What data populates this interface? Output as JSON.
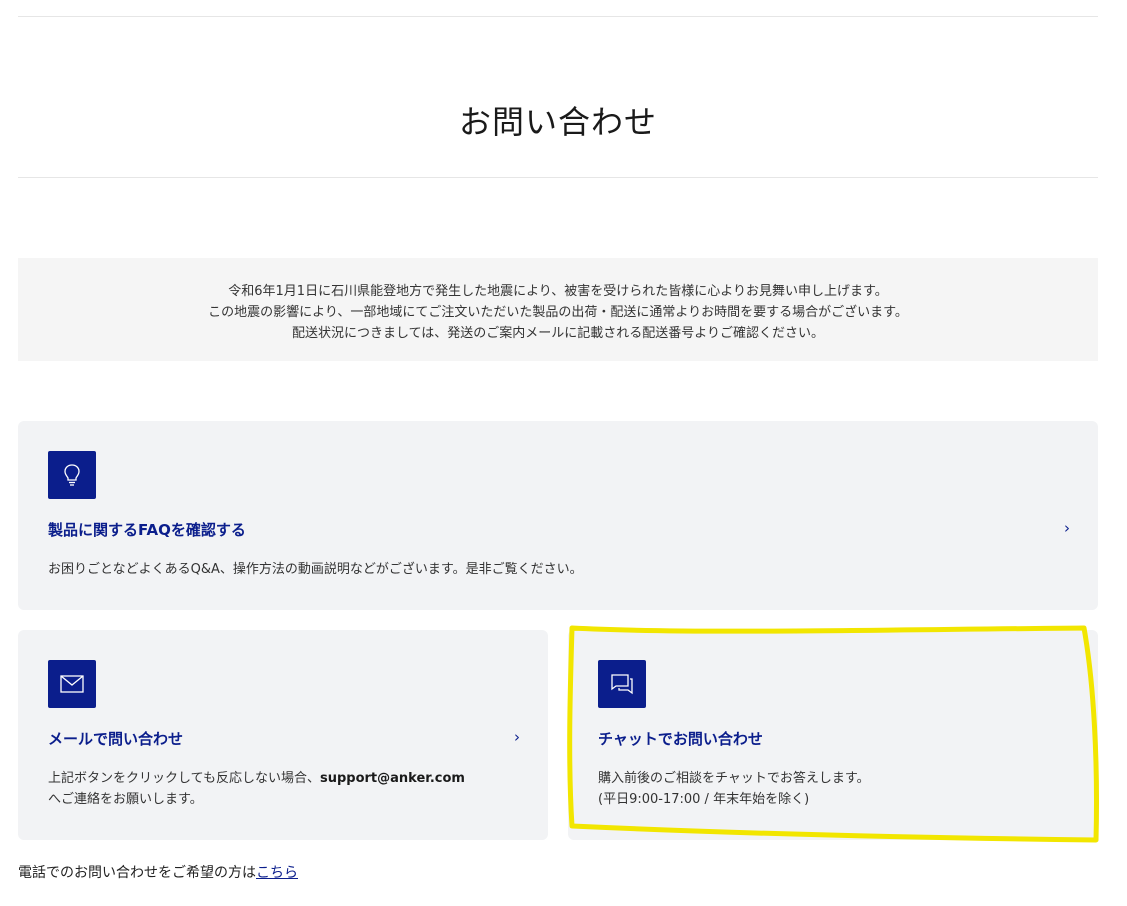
{
  "header": {
    "title": "お問い合わせ"
  },
  "notice": {
    "lines": [
      "令和6年1月1日に石川県能登地方で発生した地震により、被害を受けられた皆様に心よりお見舞い申し上げます。",
      "この地震の影響により、一部地域にてご注文いただいた製品の出荷・配送に通常よりお時間を要する場合がございます。",
      "配送状況につきましては、発送のご案内メールに記載される配送番号よりご確認ください。"
    ]
  },
  "cards": {
    "faq": {
      "icon": "lightbulb-icon",
      "title": "製品に関するFAQを確認する",
      "chevron": "›",
      "description": "お困りごとなどよくあるQ&A、操作方法の動画説明などがございます。是非ご覧ください。"
    },
    "mail": {
      "icon": "envelope-icon",
      "title": "メールで問い合わせ",
      "chevron": "›",
      "description_prefix": "上記ボタンをクリックしても反応しない場合、",
      "email": "support@anker.com",
      "description_suffix": "へご連絡をお願いします。"
    },
    "chat": {
      "icon": "chat-icon",
      "title": "チャットでお問い合わせ",
      "description_line1": "購入前後のご相談をチャットでお答えします。",
      "description_line2": "(平日9:00-17:00 / 年末年始を除く)"
    }
  },
  "footer": {
    "text": "電話でのお問い合わせをご希望の方は",
    "link_label": "こちら"
  },
  "colors": {
    "brand": "#0b1e8c",
    "card_bg": "#f2f3f5",
    "notice_bg": "#f5f5f5",
    "highlight": "#f2e600"
  }
}
